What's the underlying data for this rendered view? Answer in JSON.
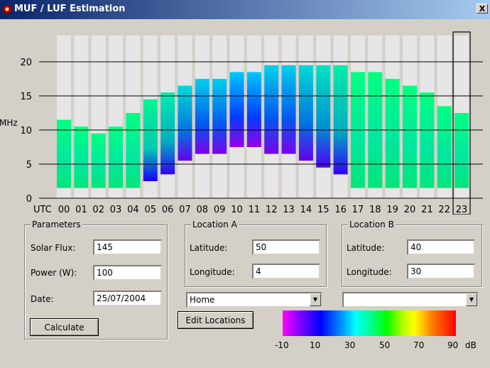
{
  "window": {
    "title": "MUF / LUF Estimation",
    "close_label": "X"
  },
  "colors": {
    "titlebar": "#0a246a",
    "face": "#d4d0c8",
    "accent": "#000000"
  },
  "chart_data": {
    "type": "bar",
    "ylabel": "MHz",
    "xlabel_prefix": "UTC",
    "ylim": [
      0,
      25
    ],
    "yticks": [
      0,
      5,
      10,
      15,
      20
    ],
    "grid": true,
    "categories": [
      "00",
      "01",
      "02",
      "03",
      "04",
      "05",
      "06",
      "07",
      "08",
      "09",
      "10",
      "11",
      "12",
      "13",
      "14",
      "15",
      "16",
      "17",
      "18",
      "19",
      "20",
      "21",
      "22",
      "23"
    ],
    "muf": [
      11.5,
      10.5,
      9.5,
      10.5,
      12.5,
      14.5,
      15.5,
      16.5,
      17.5,
      17.5,
      18.5,
      18.5,
      19.5,
      19.5,
      19.5,
      19.5,
      19.5,
      18.5,
      18.5,
      17.5,
      16.5,
      15.5,
      13.5,
      12.5
    ],
    "luf": [
      1.5,
      1.5,
      1.5,
      1.5,
      1.5,
      2.5,
      3.5,
      5.5,
      6.5,
      6.5,
      7.5,
      7.5,
      6.5,
      6.5,
      5.5,
      4.5,
      3.5,
      1.5,
      1.5,
      1.5,
      1.5,
      1.5,
      1.5,
      1.5
    ],
    "selected_hour": "23"
  },
  "parameters": {
    "title": "Parameters",
    "solar_flux_label": "Solar Flux:",
    "solar_flux": "145",
    "power_label": "Power (W):",
    "power": "100",
    "date_label": "Date:",
    "date": "25/07/2004",
    "calculate_label": "Calculate"
  },
  "location_a": {
    "title": "Location A",
    "lat_label": "Latitude:",
    "lat": "50",
    "lon_label": "Longitude:",
    "lon": "4",
    "preset": "Home"
  },
  "location_b": {
    "title": "Location B",
    "lat_label": "Latitude:",
    "lat": "40",
    "lon_label": "Longitude:",
    "lon": "30",
    "preset": ""
  },
  "edit_locations_label": "Edit Locations",
  "scale": {
    "labels": [
      "-10",
      "10",
      "30",
      "50",
      "70",
      "90"
    ],
    "unit": "dB"
  }
}
